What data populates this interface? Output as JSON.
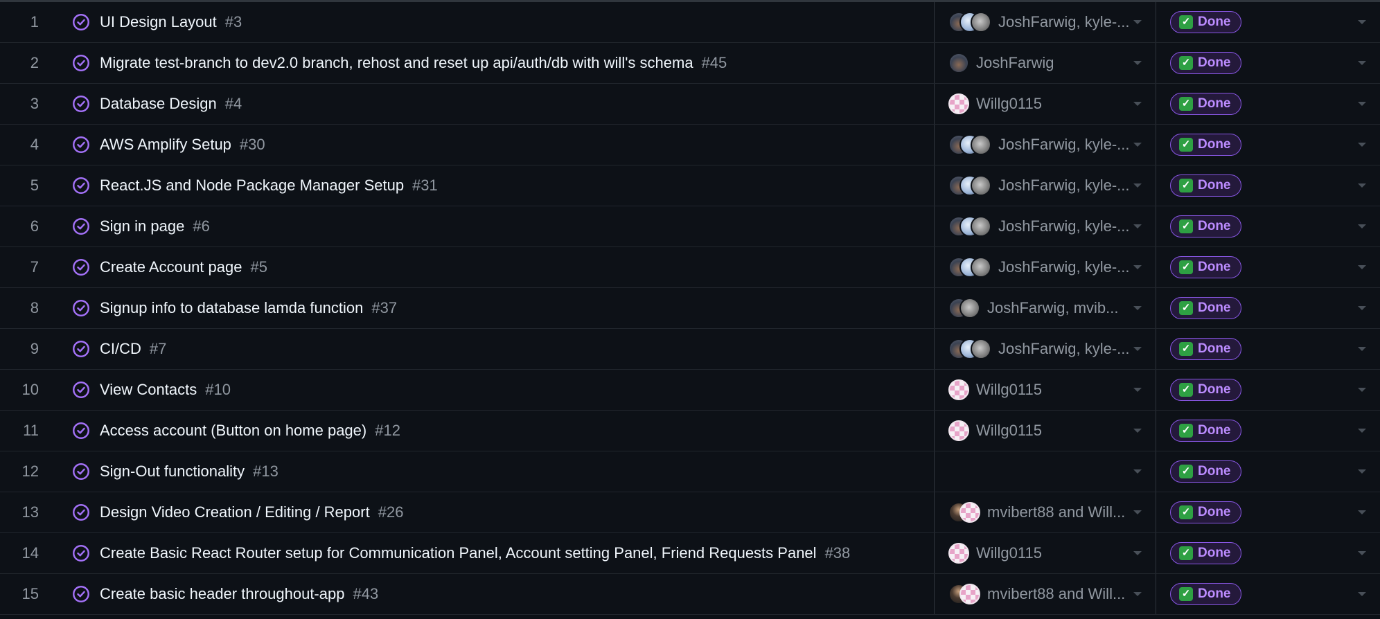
{
  "status_label": "Done",
  "check_glyph": "✓",
  "rows": [
    {
      "num": "1",
      "title": "UI Design Layout",
      "issue": "#3",
      "assignees": "JoshFarwig, kyle-...",
      "avatars": [
        "dark",
        "light",
        "grey"
      ]
    },
    {
      "num": "2",
      "title": "Migrate test-branch to dev2.0 branch, rehost and reset up api/auth/db with will's schema",
      "issue": "#45",
      "assignees": "JoshFarwig",
      "avatars": [
        "dark"
      ]
    },
    {
      "num": "3",
      "title": "Database Design",
      "issue": "#4",
      "assignees": "Willg0115",
      "avatars": [
        "identicon"
      ]
    },
    {
      "num": "4",
      "title": "AWS Amplify Setup",
      "issue": "#30",
      "assignees": "JoshFarwig, kyle-...",
      "avatars": [
        "dark",
        "light",
        "grey"
      ]
    },
    {
      "num": "5",
      "title": "React.JS and Node Package Manager Setup",
      "issue": "#31",
      "assignees": "JoshFarwig, kyle-...",
      "avatars": [
        "dark",
        "light",
        "grey"
      ]
    },
    {
      "num": "6",
      "title": "Sign in page",
      "issue": "#6",
      "assignees": "JoshFarwig, kyle-...",
      "avatars": [
        "dark",
        "light",
        "grey"
      ]
    },
    {
      "num": "7",
      "title": "Create Account page",
      "issue": "#5",
      "assignees": "JoshFarwig, kyle-...",
      "avatars": [
        "dark",
        "light",
        "grey"
      ]
    },
    {
      "num": "8",
      "title": "Signup info to database lamda function",
      "issue": "#37",
      "assignees": "JoshFarwig, mvib...",
      "avatars": [
        "dark",
        "grey"
      ]
    },
    {
      "num": "9",
      "title": "CI/CD",
      "issue": "#7",
      "assignees": "JoshFarwig, kyle-...",
      "avatars": [
        "dark",
        "light",
        "grey"
      ]
    },
    {
      "num": "10",
      "title": "View Contacts",
      "issue": "#10",
      "assignees": "Willg0115",
      "avatars": [
        "identicon"
      ]
    },
    {
      "num": "11",
      "title": "Access account (Button on home page)",
      "issue": "#12",
      "assignees": "Willg0115",
      "avatars": [
        "identicon"
      ]
    },
    {
      "num": "12",
      "title": "Sign-Out functionality",
      "issue": "#13",
      "assignees": "",
      "avatars": []
    },
    {
      "num": "13",
      "title": "Design Video Creation / Editing / Report",
      "issue": "#26",
      "assignees": "mvibert88 and Will...",
      "avatars": [
        "photo",
        "identicon"
      ]
    },
    {
      "num": "14",
      "title": "Create Basic React Router setup for Communication Panel, Account setting Panel, Friend Requests Panel",
      "issue": "#38",
      "assignees": "Willg0115",
      "avatars": [
        "identicon"
      ]
    },
    {
      "num": "15",
      "title": "Create basic header throughout-app",
      "issue": "#43",
      "assignees": "mvibert88 and Will...",
      "avatars": [
        "photo",
        "identicon"
      ]
    }
  ]
}
